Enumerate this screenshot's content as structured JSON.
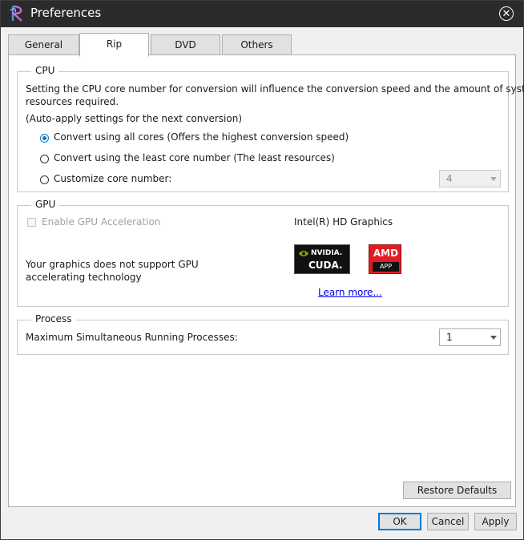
{
  "window": {
    "title": "Preferences"
  },
  "tabs": [
    {
      "label": "General"
    },
    {
      "label": "Rip"
    },
    {
      "label": "DVD"
    },
    {
      "label": "Others"
    }
  ],
  "cpu": {
    "legend": "CPU",
    "description_line1": "Setting the CPU core number for conversion will influence the conversion speed and the amount of system",
    "description_line2": "resources required.",
    "auto_apply_note": "(Auto-apply settings for the next conversion)",
    "options": [
      {
        "label": "Convert using all cores (Offers the highest conversion speed)",
        "selected": true
      },
      {
        "label": "Convert using the least core number (The least resources)",
        "selected": false
      },
      {
        "label": "Customize core number:",
        "selected": false
      }
    ],
    "core_number_value": "4"
  },
  "gpu": {
    "legend": "GPU",
    "enable_label": "Enable GPU Acceleration",
    "enable_checked": false,
    "adapter_name": "Intel(R) HD Graphics",
    "unsupported_line1": "Your graphics does not support GPU",
    "unsupported_line2": "accelerating technology",
    "nvidia_logo_top": "NVIDIA.",
    "nvidia_logo_bottom": "CUDA.",
    "amd_logo_top": "AMD",
    "amd_logo_bottom": "APP",
    "learn_more": "Learn more..."
  },
  "process": {
    "legend": "Process",
    "max_label": "Maximum Simultaneous Running Processes:",
    "max_value": "1"
  },
  "buttons": {
    "restore_defaults": "Restore Defaults",
    "ok": "OK",
    "cancel": "Cancel",
    "apply": "Apply"
  },
  "colors": {
    "titlebar": "#2b2b2b",
    "accent": "#0078d7",
    "nvidia_green": "#76b900",
    "amd_red": "#e31b23"
  }
}
